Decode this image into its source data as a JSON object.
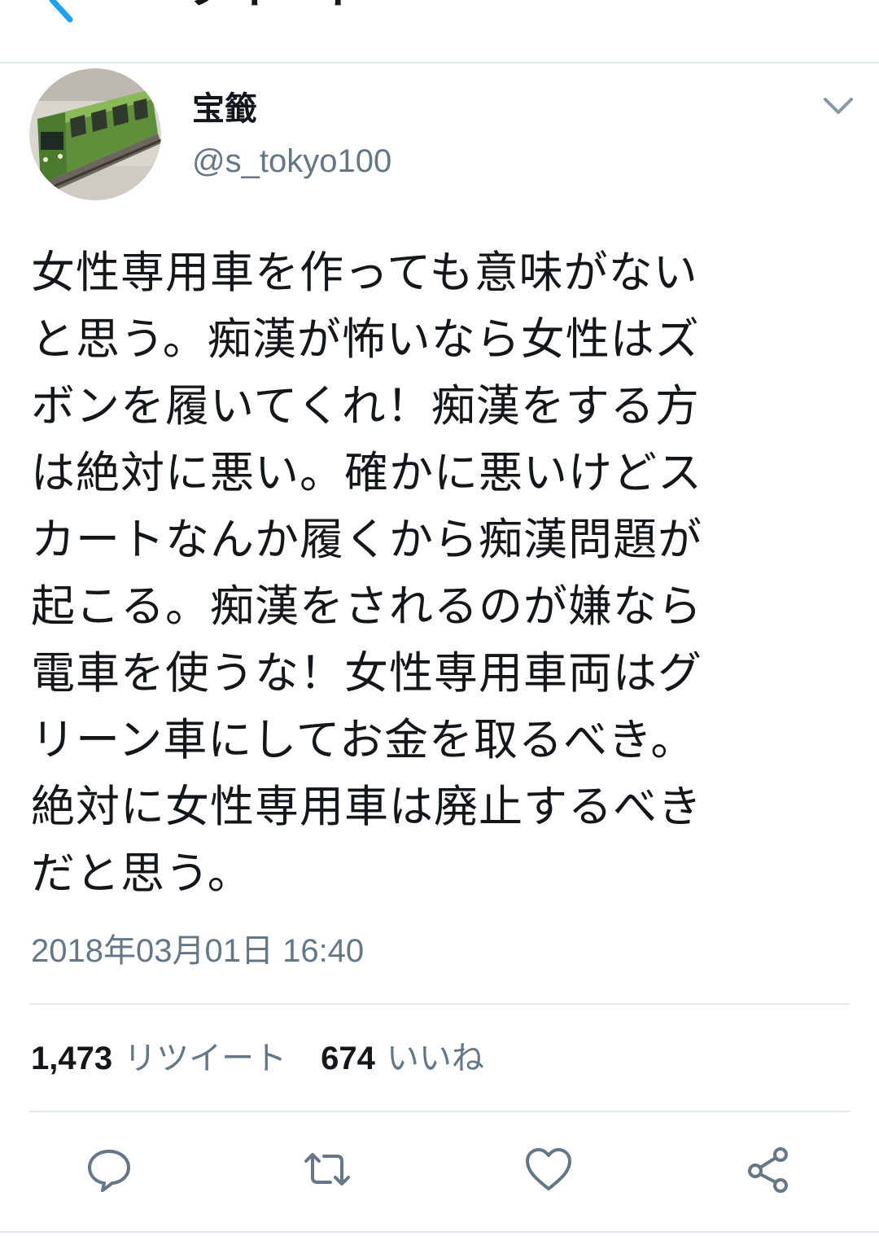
{
  "header": {
    "title": "ツイート",
    "back_icon": "chevron-left-icon"
  },
  "author": {
    "display_name": "宝籤",
    "handle": "@s_tokyo100",
    "avatar": "avatar-train-photo",
    "menu_icon": "chevron-down-icon"
  },
  "tweet": {
    "text": "女性専用車を作っても意味がない\nと思う。痴漢が怖いなら女性はズ\nボンを履いてくれ！痴漢をする方\nは絶対に悪い。確かに悪いけどス\nカートなんか履くから痴漢問題が\n起こる。痴漢をされるのが嫌なら\n電車を使うな！女性専用車両はグ\nリーン車にしてお金を取るべき。\n絶対に女性専用車は廃止するべき\nだと思う。",
    "timestamp": "2018年03月01日 16:40"
  },
  "stats": {
    "retweets_count": "1,473",
    "retweets_label": "リツイート",
    "likes_count": "674",
    "likes_label": "いいね"
  },
  "actions": {
    "reply_icon": "reply-icon",
    "retweet_icon": "retweet-icon",
    "like_icon": "heart-icon",
    "share_icon": "share-icon"
  },
  "colors": {
    "text_primary": "#14171a",
    "text_secondary": "#657786",
    "icon_gray": "#657786",
    "divider": "#e1e8ed",
    "accent": "#1da1f2"
  }
}
